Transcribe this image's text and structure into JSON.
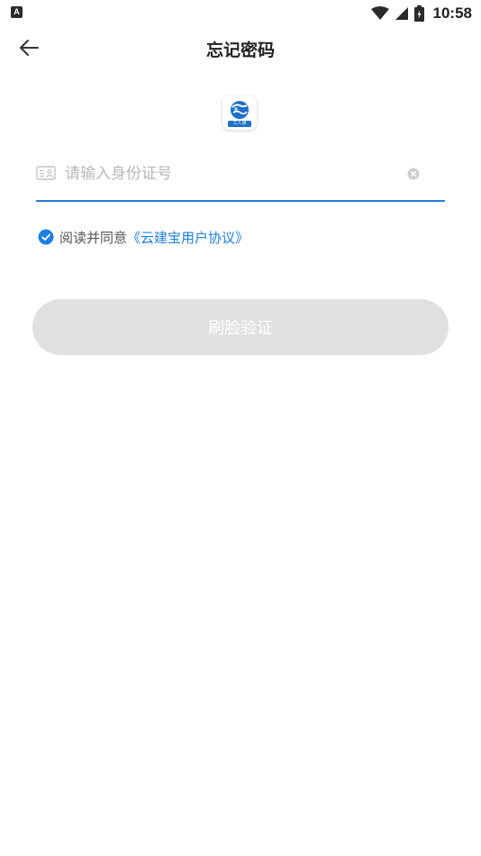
{
  "status_bar": {
    "notification_icon": "a-badge-icon",
    "time": "10:58",
    "icons": [
      "wifi-icon",
      "cellular-signal-icon",
      "battery-icon"
    ]
  },
  "header": {
    "title": "忘记密码",
    "back_icon": "arrow-left-icon"
  },
  "logo": {
    "caption": "工人通"
  },
  "form": {
    "id_input": {
      "placeholder": "请输入身份证号",
      "value": "",
      "icon": "id-card-icon",
      "clear_icon": "clear-icon"
    },
    "agreement": {
      "checked": true,
      "prefix": "阅读并同意",
      "link_text": "《云建宝用户协议》"
    },
    "submit_label": "刷脸验证"
  },
  "colors": {
    "accent": "#1e7fe0",
    "button_disabled_bg": "#e0e0e0",
    "placeholder": "#b8b8b8"
  }
}
